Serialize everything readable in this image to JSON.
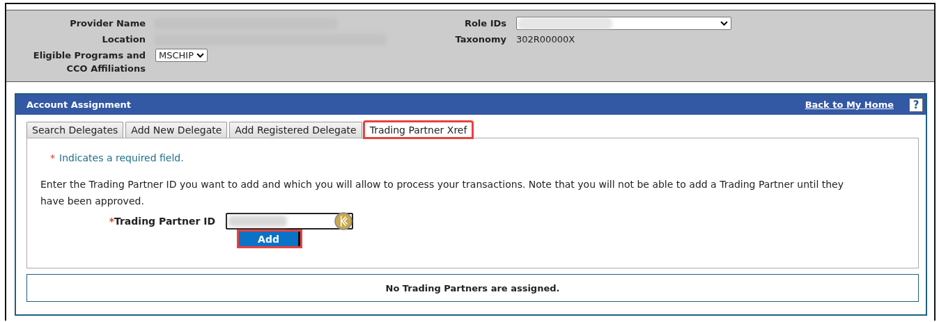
{
  "provider": {
    "fields": [
      {
        "label": "Provider Name",
        "kind": "redacted"
      },
      {
        "label": "Location",
        "kind": "redacted"
      },
      {
        "label": "Eligible Programs and CCO Affiliations",
        "kind": "select",
        "value": "MSCHIP"
      }
    ],
    "right_fields": [
      {
        "label": "Role IDs",
        "kind": "redacted-select"
      },
      {
        "label": "Taxonomy",
        "kind": "text",
        "value": "302R00000X"
      }
    ]
  },
  "panel": {
    "title": "Account Assignment",
    "back_link": "Back to My Home",
    "help": "?"
  },
  "tabs": [
    {
      "label": "Search Delegates",
      "selected": false,
      "highlighted": false
    },
    {
      "label": "Add New Delegate",
      "selected": false,
      "highlighted": false
    },
    {
      "label": "Add Registered Delegate",
      "selected": false,
      "highlighted": false
    },
    {
      "label": "Trading Partner Xref",
      "selected": true,
      "highlighted": true
    }
  ],
  "required_note": {
    "mark": "*",
    "text": "Indicates a required field."
  },
  "instructions": "Enter the Trading Partner ID you want to add and which you will allow to process your transactions. Note that you will not be able to add a Trading Partner until they have been approved.",
  "trading_partner_field": {
    "mark": "*",
    "label": "Trading Partner ID",
    "value_redacted": true
  },
  "add_button": {
    "label": "Add",
    "highlighted": true
  },
  "result_message": "No Trading Partners are assigned."
}
